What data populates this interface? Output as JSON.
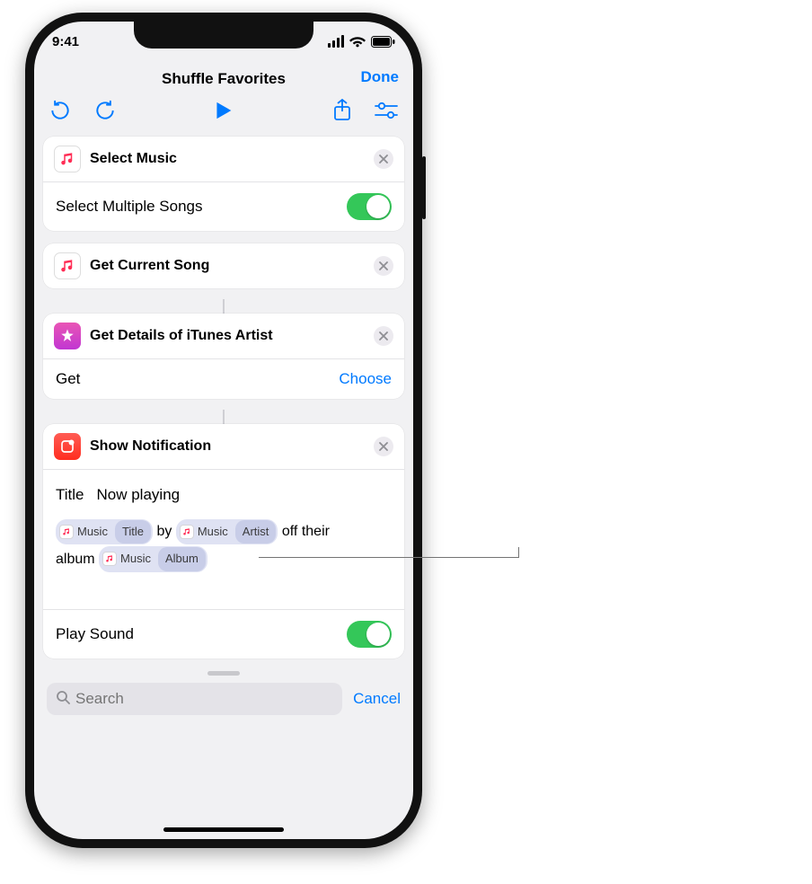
{
  "status": {
    "time": "9:41"
  },
  "nav": {
    "title": "Shuffle Favorites",
    "done": "Done"
  },
  "actions": {
    "card1": {
      "title": "Select Music",
      "row1_label": "Select Multiple Songs"
    },
    "card2": {
      "title": "Get Current Song"
    },
    "card3": {
      "title": "Get Details of iTunes Artist",
      "row_label": "Get",
      "row_link": "Choose"
    },
    "card4": {
      "title": "Show Notification",
      "title_field_label": "Title",
      "title_field_value": "Now playing",
      "tokens": {
        "t1_main": "Music",
        "t1_sub": "Title",
        "joiner1": "by",
        "t2_main": "Music",
        "t2_sub": "Artist",
        "joiner2": "off their",
        "joiner3": "album",
        "t3_main": "Music",
        "t3_sub": "Album"
      },
      "play_sound_label": "Play Sound"
    }
  },
  "search": {
    "placeholder": "Search",
    "cancel": "Cancel"
  }
}
